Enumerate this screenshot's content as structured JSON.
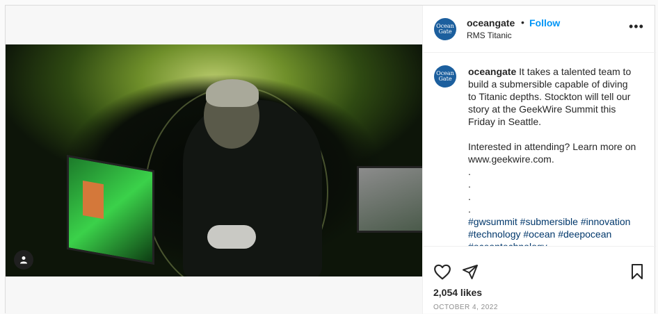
{
  "post": {
    "username": "oceangate",
    "follow_label": "Follow",
    "separator": "•",
    "location": "RMS Titanic",
    "more_icon": "more-options-icon",
    "logo_text_line1": "Ocean",
    "logo_text_line2": "Gate",
    "caption_text": " It takes a talented team to build a submersible capable of diving to Titanic depths. Stockton will tell our story at the GeekWire Summit this Friday in Seattle.\n\nInterested in attending? Learn more on www.geekwire.com.\n.\n.\n.\n.\n",
    "hashtags": "#gwsummit #submersible #innovation #technology #ocean #deepocean #oceantechnology",
    "likes": "2,054 likes",
    "date": "OCTOBER 4, 2022"
  },
  "colors": {
    "accent": "#0095f6",
    "hashtag": "#00376b",
    "text": "#262626",
    "muted": "#8e8e8e"
  },
  "icons": [
    "heart-icon",
    "share-icon",
    "bookmark-icon",
    "user-tag-icon"
  ]
}
